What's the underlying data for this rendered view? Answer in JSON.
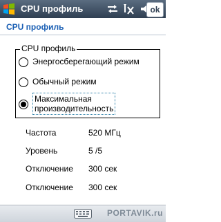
{
  "titlebar": {
    "title": "CPU профиль",
    "ok_label": "ok",
    "icons": [
      "windows-logo",
      "sync-arrows-icon",
      "no-signal-icon",
      "speaker-mute-icon"
    ]
  },
  "header": {
    "title": "CPU профиль"
  },
  "profile_group": {
    "legend": "CPU профиль",
    "options": [
      {
        "label": "Энергосберегающий режим",
        "selected": false
      },
      {
        "label": "Обычный режим",
        "selected": false
      },
      {
        "label_line1": "Максимальная",
        "label_line2": "производительность",
        "selected": true
      }
    ]
  },
  "info": [
    {
      "label": "Частота",
      "value": "520 МГц"
    },
    {
      "label": "Уровень",
      "value": "5 /5"
    },
    {
      "label": "Отключение",
      "value": "300 сек"
    },
    {
      "label": "Отключение",
      "value": "300 сек"
    }
  ],
  "bottombar": {
    "keyboard_icon": "keyboard-icon",
    "watermark": "PORTAVIK.ru"
  }
}
